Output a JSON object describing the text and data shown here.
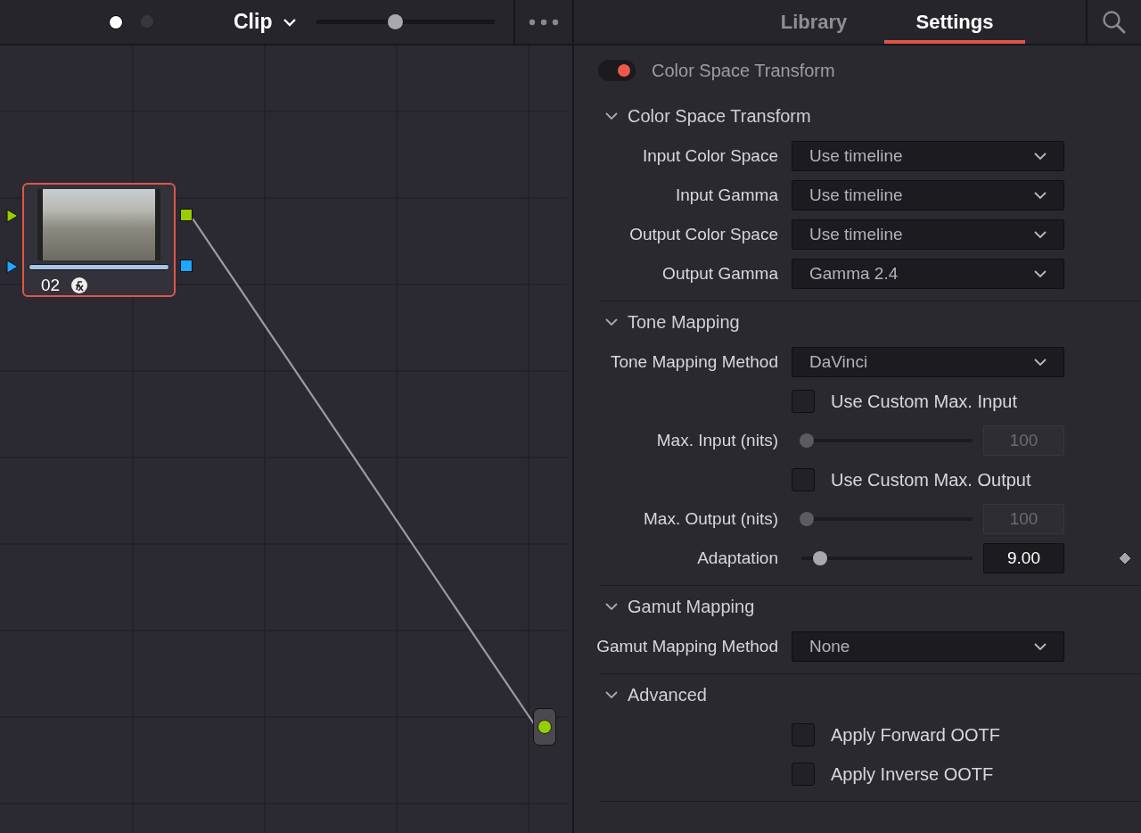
{
  "node_editor": {
    "pages": [
      {
        "selected": true
      },
      {
        "selected": false
      }
    ],
    "scope_menu": {
      "label": "Clip"
    },
    "zoom_slider": {
      "level": 0.44
    },
    "node": {
      "label": "02",
      "selected": true
    }
  },
  "sidebar": {
    "tabs": [
      {
        "label": "Library",
        "selected": false
      },
      {
        "label": "Settings",
        "selected": true
      }
    ]
  },
  "effect": {
    "title": "Color Space Transform",
    "on": true,
    "sections": [
      {
        "title": "Color Space Transform",
        "expanded": true,
        "rows": [
          {
            "kind": "dropdown",
            "label": "Input Color Space",
            "value": "Use timeline"
          },
          {
            "kind": "dropdown",
            "label": "Input Gamma",
            "value": "Use timeline"
          },
          {
            "kind": "dropdown",
            "label": "Output Color Space",
            "value": "Use timeline"
          },
          {
            "kind": "dropdown",
            "label": "Output Gamma",
            "value": "Gamma 2.4"
          }
        ]
      },
      {
        "title": "Tone Mapping",
        "expanded": true,
        "rows": [
          {
            "kind": "dropdown",
            "label": "Tone Mapping Method",
            "value": "DaVinci"
          },
          {
            "kind": "checkbox",
            "label": "Use Custom Max. Input",
            "checked": false
          },
          {
            "kind": "slider",
            "label": "Max. Input (nits)",
            "level": 0,
            "value": "100",
            "disabled": true
          },
          {
            "kind": "checkbox",
            "label": "Use Custom Max. Output",
            "checked": false
          },
          {
            "kind": "slider",
            "label": "Max. Output (nits)",
            "level": 0,
            "value": "100",
            "disabled": true
          },
          {
            "kind": "slider",
            "label": "Adaptation",
            "level": 0.07,
            "value": "9.00",
            "disabled": false,
            "keyframe": true
          }
        ]
      },
      {
        "title": "Gamut Mapping",
        "expanded": true,
        "rows": [
          {
            "kind": "dropdown",
            "label": "Gamut Mapping Method",
            "value": "None"
          }
        ]
      },
      {
        "title": "Advanced",
        "expanded": true,
        "rows": [
          {
            "kind": "checkbox",
            "label": "Apply Forward OOTF",
            "checked": false
          },
          {
            "kind": "checkbox",
            "label": "Apply Inverse OOTF",
            "checked": false
          }
        ]
      }
    ]
  }
}
